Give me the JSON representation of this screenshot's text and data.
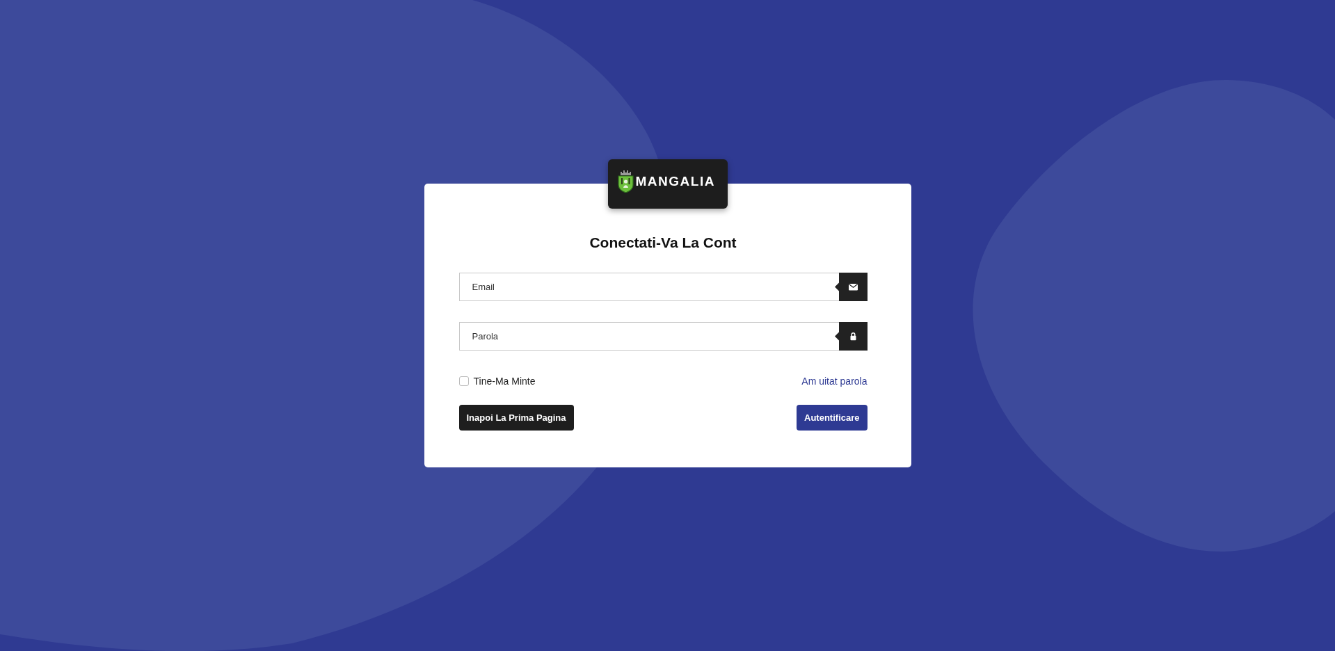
{
  "logo": {
    "text": "MANGALIA"
  },
  "form": {
    "title": "Conectati-Va La Cont",
    "fields": [
      {
        "kind": "email",
        "placeholder": "Email"
      },
      {
        "kind": "password",
        "placeholder": "Parola"
      }
    ],
    "remember": {
      "label": "Tine-Ma Minte",
      "checked": false
    },
    "forgot_link": "Am uitat parola",
    "buttons": [
      {
        "kind": "secondary",
        "label": "Inapoi La Prima Pagina"
      },
      {
        "kind": "primary",
        "label": "Autentificare"
      }
    ]
  }
}
